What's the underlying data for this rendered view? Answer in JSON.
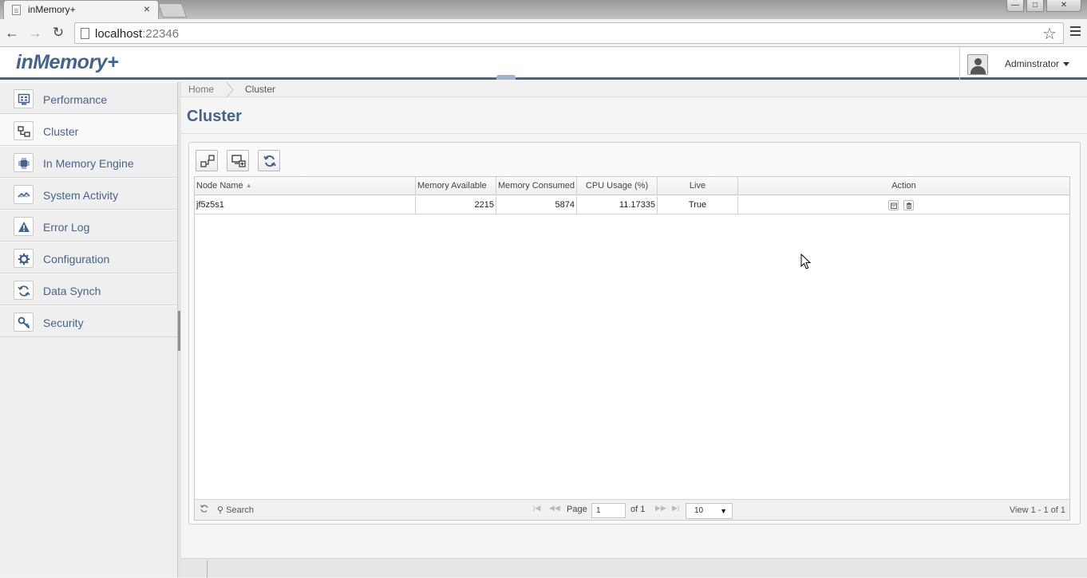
{
  "browser": {
    "tab_title": "inMemory+",
    "tab_close": "×",
    "url_host": "localhost",
    "url_port": ":22346",
    "window_min": "—",
    "window_max": "□",
    "window_close": "✕"
  },
  "header": {
    "logo": "inMemory+",
    "user_name": "Adminstrator"
  },
  "sidebar": {
    "items": [
      {
        "label": "Performance",
        "icon": "performance-icon"
      },
      {
        "label": "Cluster",
        "icon": "cluster-icon",
        "active": true
      },
      {
        "label": "In Memory Engine",
        "icon": "chip-icon"
      },
      {
        "label": "System Activity",
        "icon": "activity-icon"
      },
      {
        "label": "Error Log",
        "icon": "warning-icon"
      },
      {
        "label": "Configuration",
        "icon": "gear-icon"
      },
      {
        "label": "Data Synch",
        "icon": "sync-icon"
      },
      {
        "label": "Security",
        "icon": "key-icon"
      }
    ]
  },
  "breadcrumb": {
    "home": "Home",
    "current": "Cluster"
  },
  "page": {
    "title": "Cluster"
  },
  "grid": {
    "columns": [
      "Node Name",
      "Memory Available",
      "Memory Consumed",
      "CPU Usage (%)",
      "Live",
      "Action"
    ],
    "rows": [
      {
        "node_name": "jf5z5s1",
        "memory_available": "2215",
        "memory_consumed": "5874",
        "cpu_usage": "11.17335",
        "live": "True"
      }
    ]
  },
  "pager": {
    "search": "Search",
    "page_label": "Page",
    "page_value": "1",
    "of_label": "of 1",
    "page_size": "10",
    "view_text": "View 1 - 1 of 1"
  },
  "colors": {
    "brand": "#44648f",
    "sidebar_bg": "#efefef"
  }
}
